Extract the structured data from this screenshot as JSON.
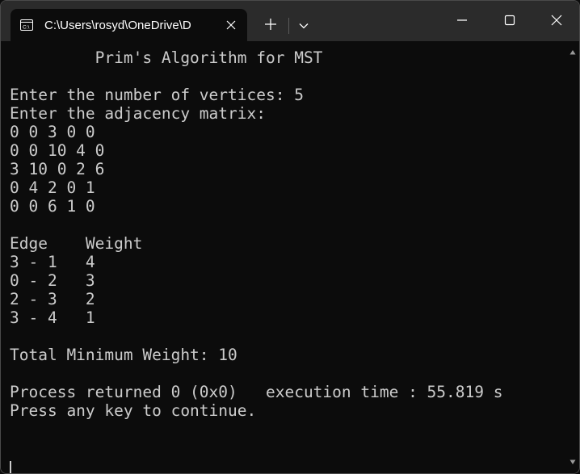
{
  "window": {
    "tab_title": "C:\\Users\\rosyd\\OneDrive\\D",
    "tab_icon": "terminal-icon",
    "buttons": {
      "tab_close": "close-icon",
      "new_tab": "plus-icon",
      "dropdown": "chevron-down-icon",
      "minimize": "minimize-icon",
      "maximize": "maximize-icon",
      "close": "close-icon"
    }
  },
  "console": {
    "lines": [
      "         Prim's Algorithm for MST",
      "",
      "Enter the number of vertices: 5",
      "Enter the adjacency matrix:",
      "0 0 3 0 0",
      "0 0 10 4 0",
      "3 10 0 2 6",
      "0 4 2 0 1",
      "0 0 6 1 0",
      "",
      "Edge    Weight",
      "3 - 1   4",
      "0 - 2   3",
      "2 - 3   2",
      "3 - 4   1",
      "",
      "Total Minimum Weight: 10",
      "",
      "Process returned 0 (0x0)   execution time : 55.819 s",
      "Press any key to continue."
    ]
  },
  "colors": {
    "background": "#0c0c0c",
    "titlebar": "#2b2b2b",
    "text": "#cccccc",
    "title_text": "#ffffff"
  }
}
